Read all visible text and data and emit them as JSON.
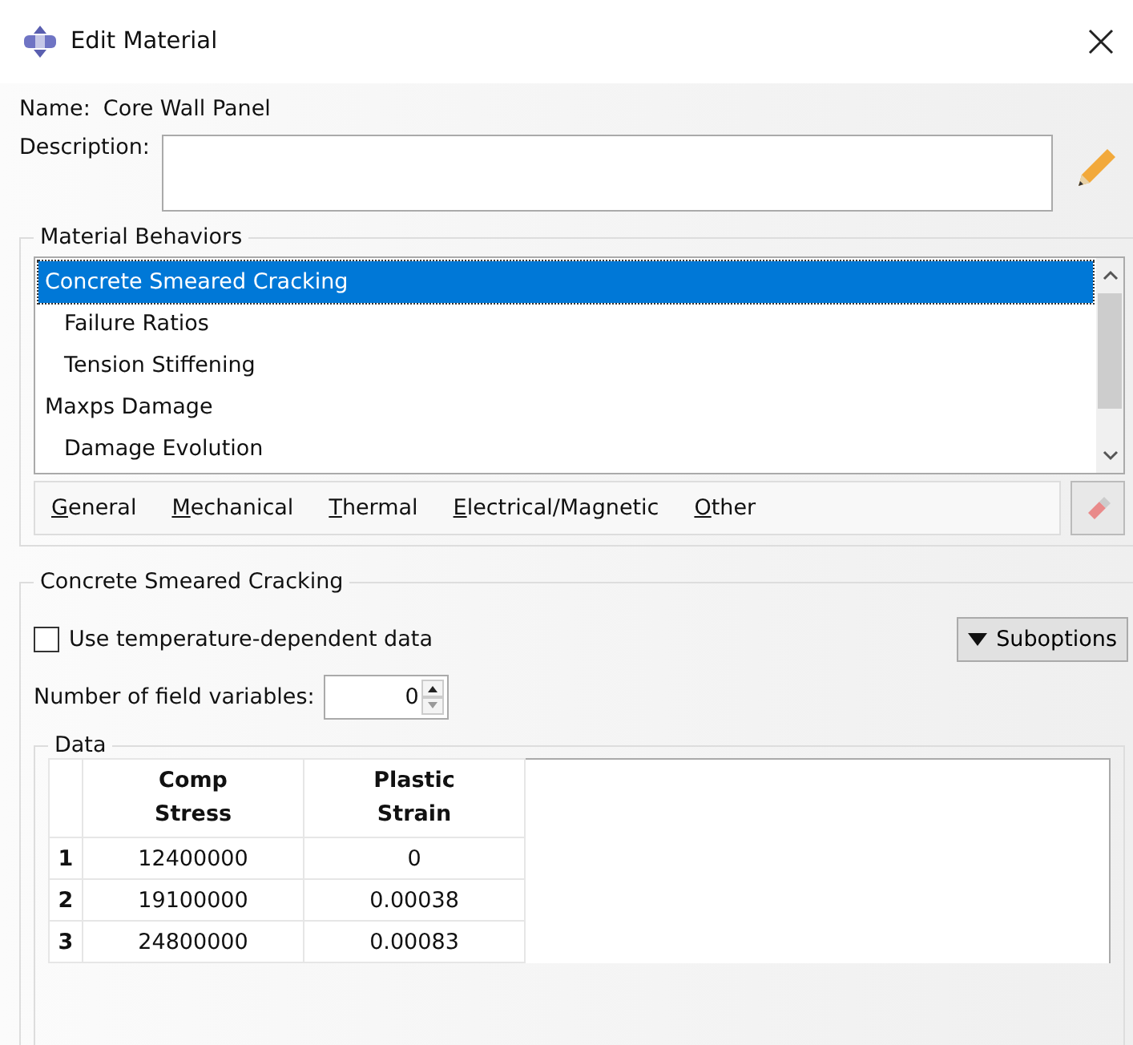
{
  "window": {
    "title": "Edit Material"
  },
  "name": {
    "label": "Name:",
    "value": "Core Wall Panel"
  },
  "description": {
    "label": "Description:"
  },
  "behaviors": {
    "title": "Material Behaviors",
    "items": [
      {
        "label": "Concrete Smeared Cracking",
        "selected": true,
        "children": [
          {
            "label": "Failure Ratios",
            "selected": false
          },
          {
            "label": "Tension Stiffening",
            "selected": false
          }
        ]
      },
      {
        "label": "Maxps Damage",
        "selected": false,
        "children": [
          {
            "label": "Damage Evolution",
            "selected": false
          }
        ]
      }
    ]
  },
  "menu": [
    "General",
    "Mechanical",
    "Thermal",
    "Electrical/Magnetic",
    "Other"
  ],
  "section": {
    "title": "Concrete Smeared Cracking",
    "temperature": {
      "label": "Use temperature-dependent data",
      "checked": false
    },
    "suboptions": "Suboptions",
    "field_variables": {
      "label": "Number of field variables:",
      "value": "0"
    },
    "data": {
      "title": "Data",
      "columns": [
        "Comp\nStress",
        "Plastic\nStrain"
      ],
      "rows": [
        {
          "index": "1",
          "cells": [
            "12400000",
            "0"
          ]
        },
        {
          "index": "2",
          "cells": [
            "19100000",
            "0.00038"
          ]
        },
        {
          "index": "3",
          "cells": [
            "24800000",
            "0.00083"
          ]
        }
      ]
    }
  }
}
